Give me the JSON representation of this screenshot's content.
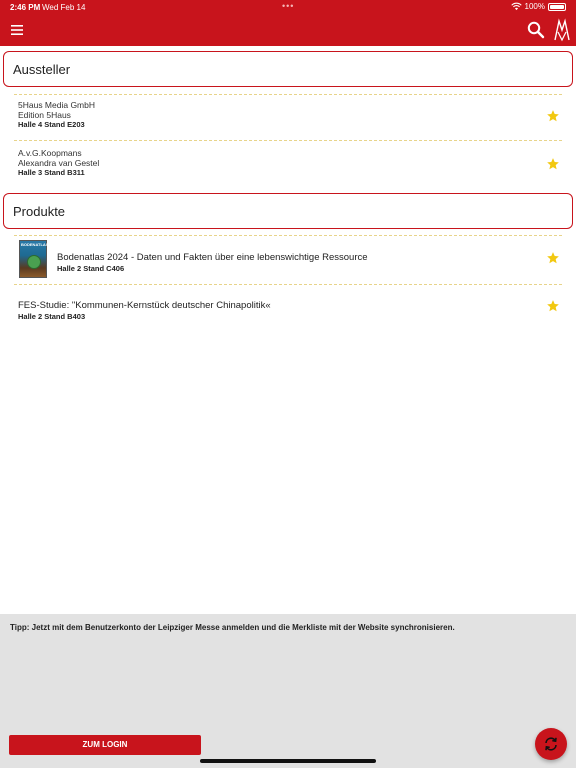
{
  "status_bar": {
    "time": "2:46 PM",
    "date": "Wed Feb 14",
    "battery": "100%"
  },
  "colors": {
    "brand_red": "#c8141c",
    "star_yellow": "#f2c811",
    "panel_gray": "#e2e2e2"
  },
  "header": {
    "menu_icon": "hamburger-menu-icon",
    "search_icon": "search-icon",
    "logo_icon": "leipziger-messe-logo-icon"
  },
  "sections": {
    "aussteller": "Aussteller",
    "produkte": "Produkte"
  },
  "exhibitors": [
    {
      "name": "5Haus Media GmbH",
      "subname": "Edition 5Haus",
      "location": "Halle 4 Stand E203",
      "favorited": true
    },
    {
      "name": "A.v.G.Koopmans",
      "subname": "Alexandra van Gestel",
      "location": "Halle 3 Stand B311",
      "favorited": true
    }
  ],
  "products": [
    {
      "title": "Bodenatlas 2024 - Daten und Fakten über eine lebenswichtige Ressource",
      "location": "Halle 2 Stand C406",
      "thumb_label": "BODENATLAS",
      "favorited": true
    },
    {
      "title": "FES-Studie: \"Kommunen-Kernstück deutscher Chinapolitik«",
      "location": "Halle 2 Stand B403",
      "favorited": true
    }
  ],
  "footer": {
    "tip": "Tipp: Jetzt mit dem Benutzerkonto der Leipziger Messe anmelden und die Merkliste mit der Website synchronisieren.",
    "login_label": "ZUM LOGIN",
    "sync_icon": "sync-icon"
  }
}
